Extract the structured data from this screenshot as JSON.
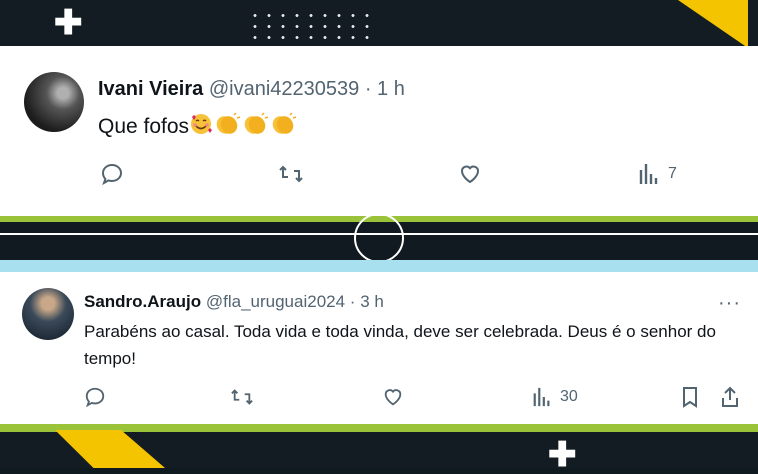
{
  "tweets": [
    {
      "name": "Ivani Vieira",
      "handle": "@ivani42230539",
      "separator": "·",
      "time": "1 h",
      "text": "Que fofos",
      "emojis": [
        "smiling-face-with-hearts",
        "clapping-hands",
        "clapping-hands",
        "clapping-hands"
      ],
      "views": "7"
    },
    {
      "name": "Sandro.Araujo",
      "handle": "@fla_uruguai2024",
      "separator": "·",
      "time": "3 h",
      "text": "Parabéns ao casal. Toda vida e toda vinda, deve ser celebrada. Deus é o senhor do tempo!",
      "views": "30",
      "more": "···"
    }
  ],
  "colors": {
    "text": "#0f1419",
    "muted": "#536471",
    "yellow": "#f5c400",
    "green": "#9bc33a"
  }
}
